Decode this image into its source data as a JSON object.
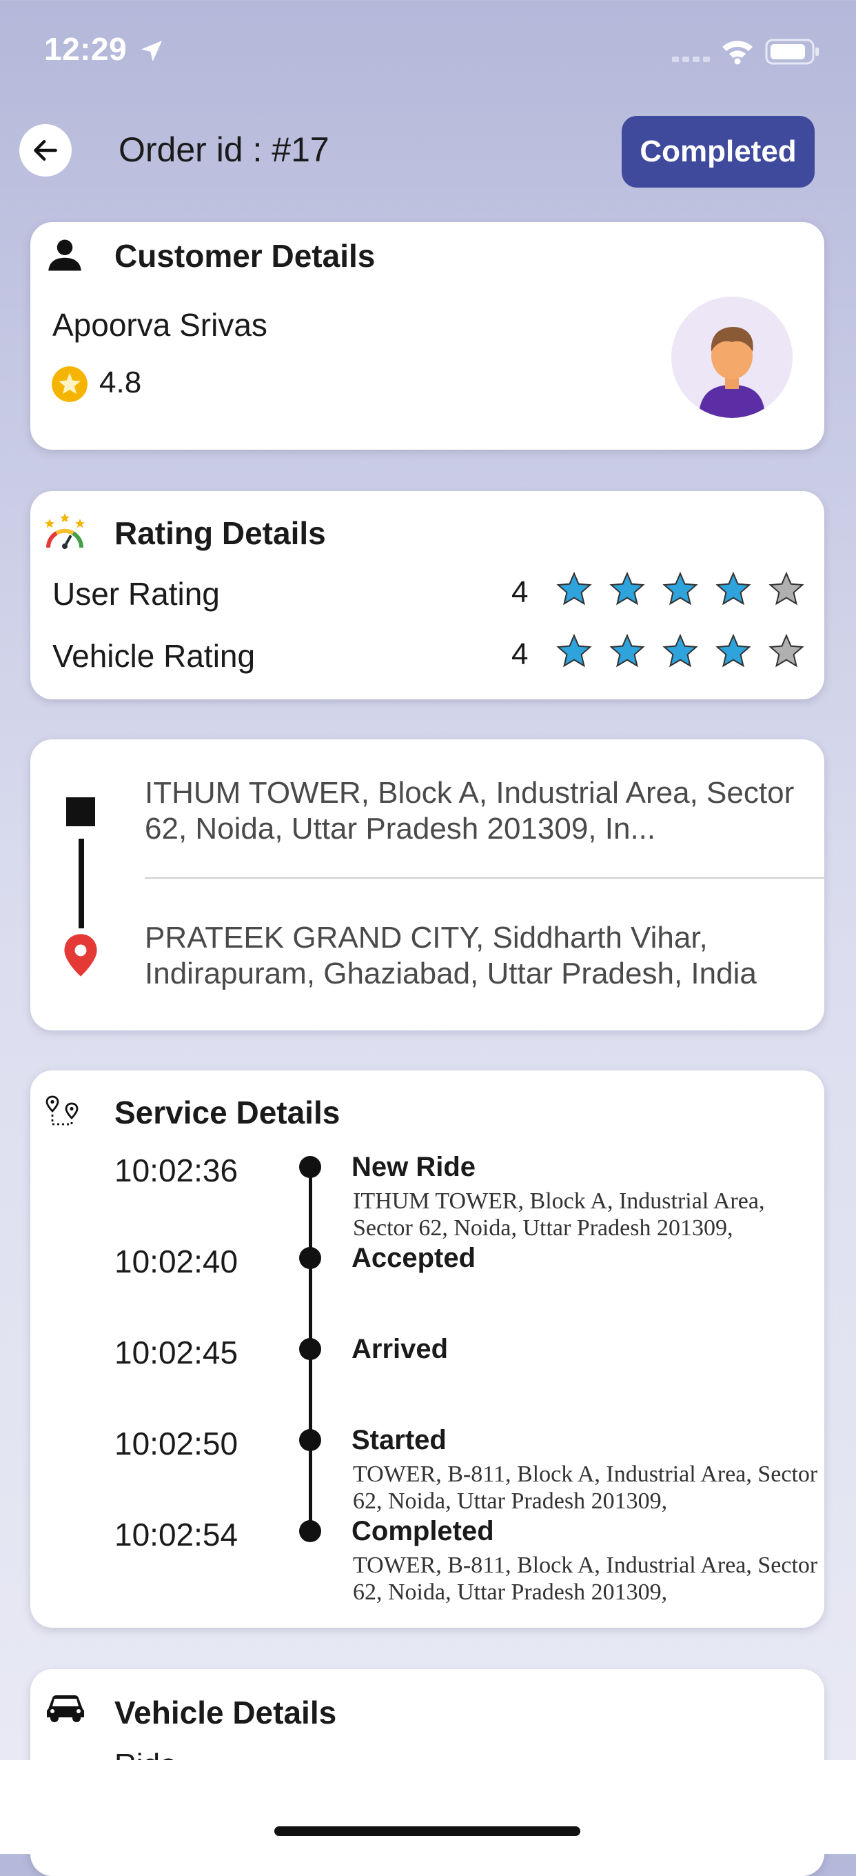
{
  "status_bar": {
    "time": "12:29"
  },
  "header": {
    "title": "Order id : #17",
    "status": "Completed"
  },
  "customer": {
    "title": "Customer Details",
    "name": "Apoorva Srivas",
    "rating": "4.8"
  },
  "rating": {
    "title": "Rating Details",
    "rows": [
      {
        "label": "User Rating",
        "value": "4",
        "stars": 4,
        "max": 5
      },
      {
        "label": "Vehicle Rating",
        "value": "4",
        "stars": 4,
        "max": 5
      }
    ]
  },
  "route": {
    "pickup": "ITHUM TOWER, Block A, Industrial Area, Sector 62, Noida, Uttar Pradesh 201309, In...",
    "drop": "PRATEEK GRAND CITY, Siddharth Vihar, Indirapuram, Ghaziabad, Uttar Pradesh, India"
  },
  "service": {
    "title": "Service Details",
    "events": [
      {
        "time": "10:02:36",
        "status": "New Ride",
        "address": "ITHUM TOWER, Block A, Industrial Area, Sector 62, Noida, Uttar Pradesh 201309,"
      },
      {
        "time": "10:02:40",
        "status": "Accepted",
        "address": ""
      },
      {
        "time": "10:02:45",
        "status": "Arrived",
        "address": ""
      },
      {
        "time": "10:02:50",
        "status": "Started",
        "address": "TOWER, B-811, Block A, Industrial Area, Sector 62, Noida, Uttar Pradesh 201309,"
      },
      {
        "time": "10:02:54",
        "status": "Completed",
        "address": "TOWER, B-811, Block A, Industrial Area, Sector 62, Noida, Uttar Pradesh 201309,"
      }
    ]
  },
  "vehicle": {
    "title": "Vehicle Details",
    "subtitle": "Ride"
  },
  "colors": {
    "accent": "#3f4a9c",
    "star_filled": "#2ea3dc",
    "star_empty": "#b0b0b0",
    "rating_badge": "#f4b400",
    "drop_pin": "#e53935"
  },
  "icons": [
    "location-arrow-icon",
    "cellular-signal-icon",
    "wifi-icon",
    "battery-icon",
    "back-arrow-icon",
    "person-icon",
    "star-badge-icon",
    "rating-gauge-icon",
    "pickup-square-icon",
    "drop-pin-icon",
    "route-map-icon",
    "car-icon",
    "star-icon"
  ]
}
